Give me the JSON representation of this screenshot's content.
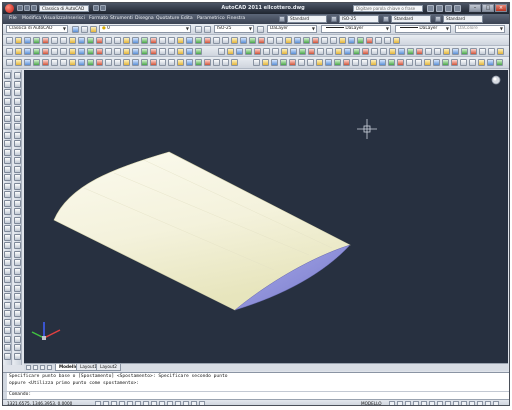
{
  "window": {
    "title": "AutoCAD 2011   ellcottero.dwg",
    "workspace": "Classica di AutoCAD",
    "help_search_placeholder": "Digitare parola chiave o frase"
  },
  "menu": {
    "items": [
      "File",
      "Modifica",
      "Visualizza",
      "Inserisci",
      "Formato",
      "Strumenti",
      "Disegna",
      "Quotature",
      "Edita",
      "Parametrico",
      "Finestra"
    ],
    "text_style": "Standard",
    "dim_style": "ISO-25",
    "table_style": "Standard",
    "mleader_style": "Standard"
  },
  "toolbar_row1": {
    "workspace": "Classica di AutoCAD",
    "layer": "0",
    "dim_style": "ISO-25",
    "color": "DaLayer",
    "linetype": "DaLayer",
    "lineweight": "DaLayer",
    "plot_style": "DaColore"
  },
  "tabs": [
    "Modello",
    "Layout1",
    "Layout2"
  ],
  "command": {
    "line1": "Specificare punto base o [Spostamento] <Spostamento>: Specificare secondo punto",
    "line2": "oppure <Utilizza primo punto come spostamento>:",
    "prompt": "Comando:"
  },
  "status": {
    "coords": "1321.6575, 1346.3953, 0.0000",
    "model": "MODELLO"
  },
  "colors": {
    "viewport_bg": "#273040",
    "surface_light": "#f4f2dc",
    "surface_shadow": "#ebe9c2",
    "side_face": "#8e90d8"
  }
}
